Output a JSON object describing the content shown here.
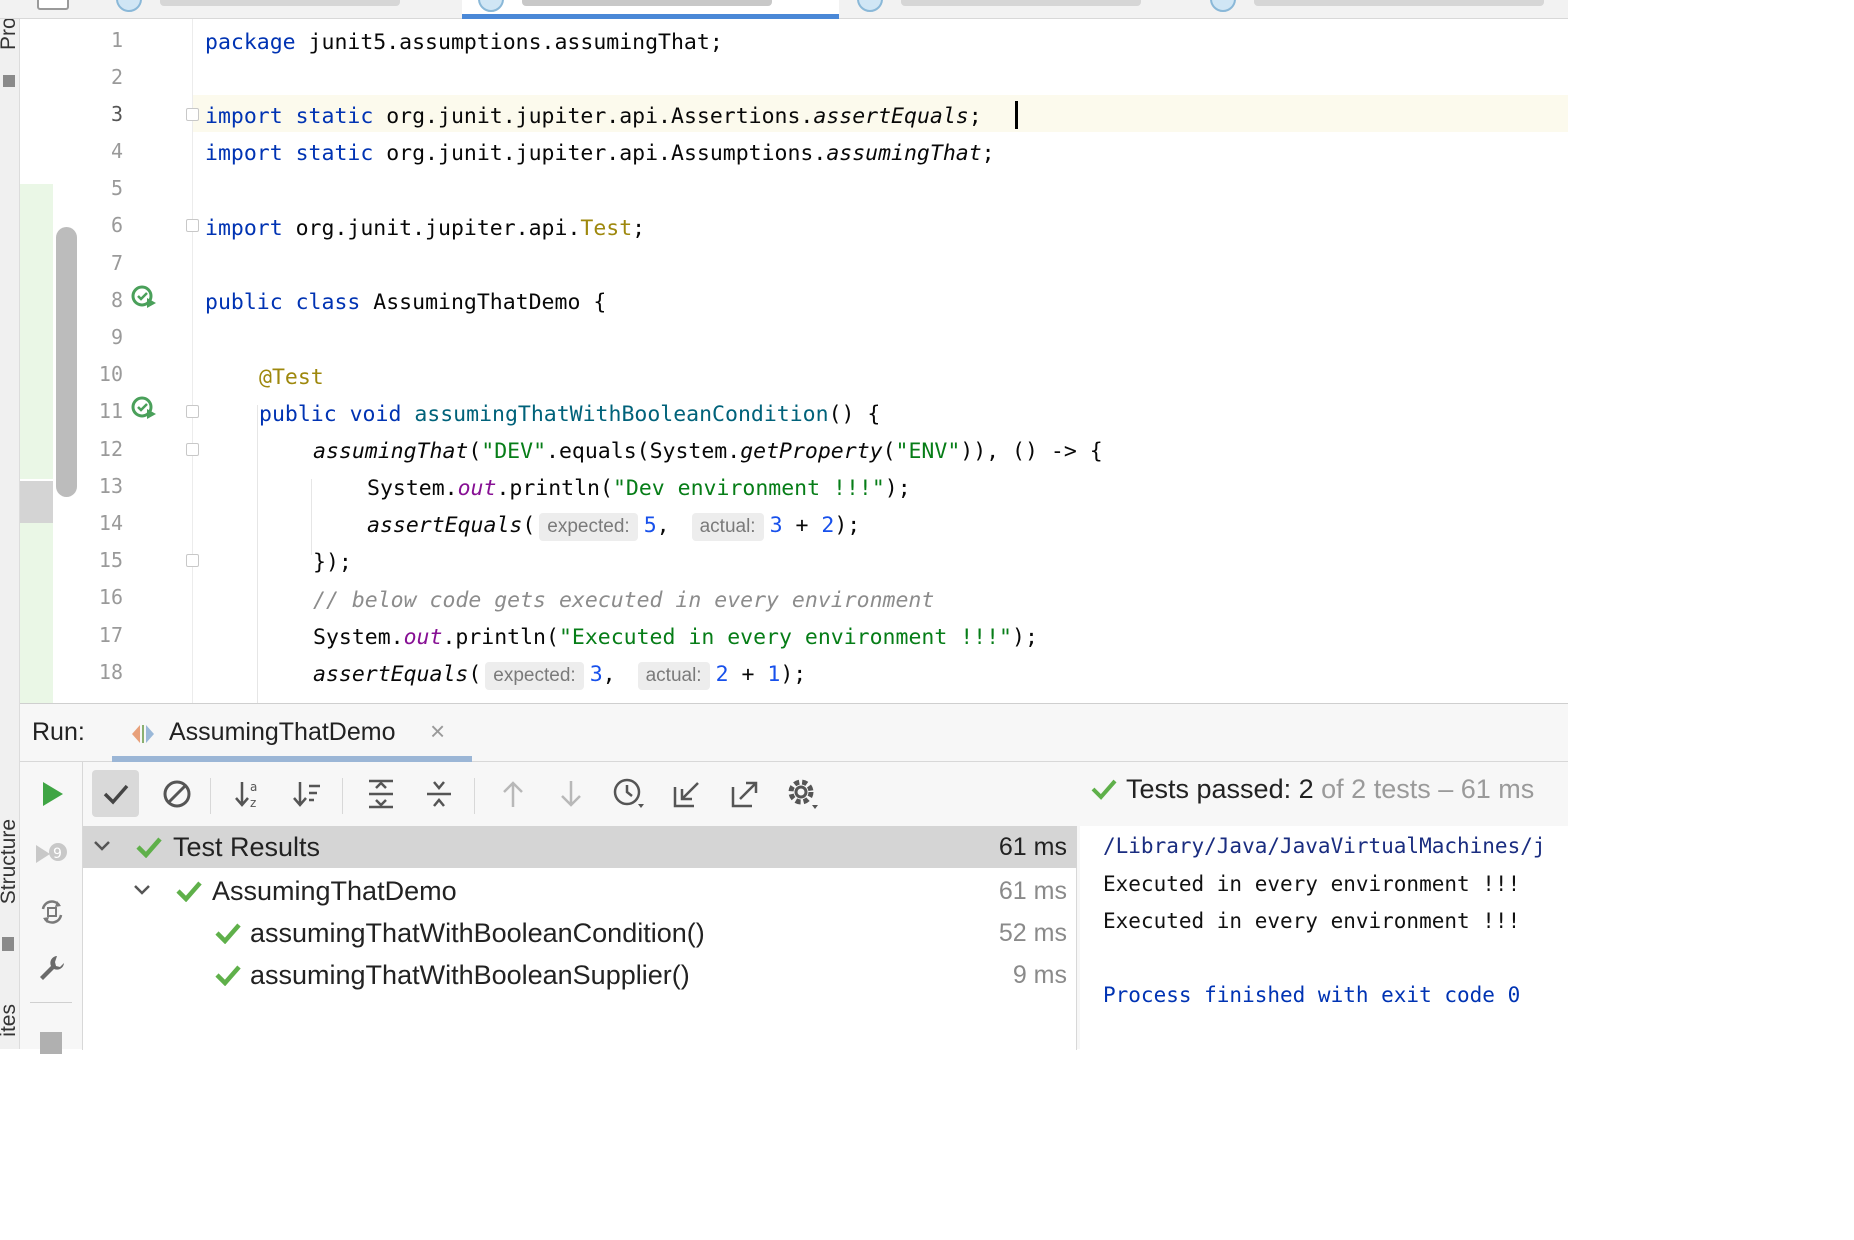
{
  "editor": {
    "lines": [
      "1",
      "2",
      "3",
      "4",
      "5",
      "6",
      "7",
      "8",
      "9",
      "10",
      "11",
      "12",
      "13",
      "14",
      "15",
      "16",
      "17",
      "18"
    ],
    "code": {
      "l1_kw": "package",
      "l1_rest": " junit5.assumptions.assumingThat;",
      "l3_kw": "import static",
      "l3_pkg": " org.junit.jupiter.api.Assertions.",
      "l3_m": "assertEquals",
      "l3_end": ";",
      "l4_kw": "import static",
      "l4_pkg": " org.junit.jupiter.api.Assumptions.",
      "l4_m": "assumingThat",
      "l4_end": ";",
      "l6_kw": "import",
      "l6_pkg": " org.junit.jupiter.api.",
      "l6_cls": "Test",
      "l6_end": ";",
      "l8_kw": "public class",
      "l8_rest": " AssumingThatDemo {",
      "l10_ann": "@Test",
      "l11_kw": "public void",
      "l11_sp": " ",
      "l11_fn": "assumingThatWithBooleanCondition",
      "l11_end": "() {",
      "l12_m": "assumingThat",
      "l12_a": "(",
      "l12_s1": "\"DEV\"",
      "l12_b": ".equals(System.",
      "l12_gp": "getProperty",
      "l12_c": "(",
      "l12_s2": "\"ENV\"",
      "l12_d": ")), () -> {",
      "l13_a": "System.",
      "l13_out": "out",
      "l13_b": ".println(",
      "l13_s": "\"Dev environment !!!\"",
      "l13_c": ");",
      "l14_m": "assertEquals",
      "l14_a": "(",
      "l14_h1": "expected:",
      "l14_n1": "5",
      "l14_b": ",",
      "l14_h2": "actual:",
      "l14_n2": "3",
      "l14_op": " + ",
      "l14_n3": "2",
      "l14_c": ");",
      "l15": "});",
      "l16": "// below code gets executed in every environment",
      "l17_a": "System.",
      "l17_out": "out",
      "l17_b": ".println(",
      "l17_s": "\"Executed in every environment !!!\"",
      "l17_c": ");",
      "l18_m": "assertEquals",
      "l18_a": "(",
      "l18_h1": "expected:",
      "l18_n1": "3",
      "l18_b": ",",
      "l18_h2": "actual:",
      "l18_n2": "2",
      "l18_op": " + ",
      "l18_n3": "1",
      "l18_c": ");"
    }
  },
  "left_strip": {
    "project_label": "Proje",
    "structure_label": "Structure",
    "favorites_label": "ites"
  },
  "run": {
    "label": "Run:",
    "tab_title": "AssumingThatDemo",
    "close_glyph": "×",
    "status_prefix": "Tests passed:",
    "status_count": "2",
    "status_suffix": "of 2 tests – 61 ms",
    "tree": [
      {
        "label": "Test Results",
        "time": "61 ms"
      },
      {
        "label": "AssumingThatDemo",
        "time": "61 ms"
      },
      {
        "label": "assumingThatWithBooleanCondition()",
        "time": "52 ms"
      },
      {
        "label": "assumingThatWithBooleanSupplier()",
        "time": "9 ms"
      }
    ],
    "console": [
      "/Library/Java/JavaVirtualMachines/j",
      "Executed in every environment !!!",
      "Executed in every environment !!!",
      "Process finished with exit code 0"
    ]
  },
  "colors": {
    "keyword": "#0033b3",
    "string": "#067d17",
    "annotation": "#9e880d",
    "number": "#1750eb",
    "pass_green": "#5fb04a",
    "accent_blue": "#4a88d7"
  },
  "icons": [
    "run-gutter-icon",
    "fold-marker-icon",
    "rerun-icon",
    "checkmark-icon",
    "cancel-icon",
    "sort-alpha-icon",
    "sort-duration-icon",
    "expand-all-icon",
    "collapse-all-icon",
    "arrow-up-icon",
    "arrow-down-icon",
    "history-icon",
    "import-icon",
    "export-icon",
    "gear-icon",
    "chevron-down-icon",
    "wrench-icon"
  ]
}
